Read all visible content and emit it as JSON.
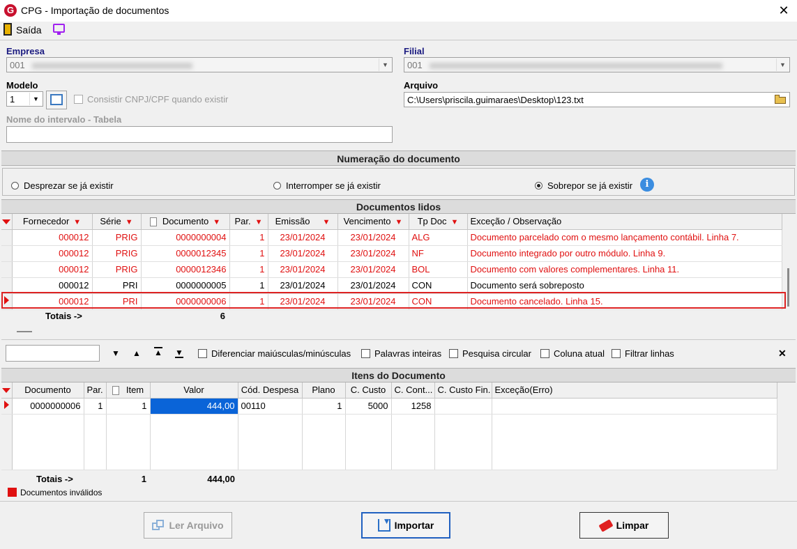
{
  "window": {
    "title": "CPG - Importação de documentos",
    "logo_letter": "G",
    "close": "✕"
  },
  "toolbar": {
    "exit_label": "Saída"
  },
  "form": {
    "empresa_label": "Empresa",
    "empresa_value": "001",
    "filial_label": "Filial",
    "filial_value": "001",
    "modelo_label": "Modelo",
    "modelo_value": "1",
    "consistir_label": "Consistir CNPJ/CPF quando existir",
    "arquivo_label": "Arquivo",
    "arquivo_value": "C:\\Users\\priscila.guimaraes\\Desktop\\123.txt",
    "intervalo_label": "Nome do intervalo - Tabela",
    "intervalo_value": ""
  },
  "numeracao": {
    "title": "Numeração do documento",
    "options": [
      "Desprezar se já existir",
      "Interromper se já existir",
      "Sobrepor se já existir"
    ],
    "selected": "Sobrepor se já existir",
    "info": "i"
  },
  "docs": {
    "title": "Documentos lidos",
    "columns": [
      "Fornecedor",
      "Série",
      "Documento",
      "Par.",
      "Emissão",
      "Vencimento",
      "Tp Doc",
      "Exceção / Observação"
    ],
    "rows": [
      {
        "fornecedor": "000012",
        "serie": "PRIG",
        "documento": "0000000004",
        "par": "1",
        "emissao": "23/01/2024",
        "vencimento": "23/01/2024",
        "tpdoc": "ALG",
        "obs": "Documento parcelado com o mesmo lançamento contábil. Linha 7."
      },
      {
        "fornecedor": "000012",
        "serie": "PRIG",
        "documento": "0000012345",
        "par": "1",
        "emissao": "23/01/2024",
        "vencimento": "23/01/2024",
        "tpdoc": "NF",
        "obs": "Documento integrado por outro módulo. Linha 9."
      },
      {
        "fornecedor": "000012",
        "serie": "PRIG",
        "documento": "0000012346",
        "par": "1",
        "emissao": "23/01/2024",
        "vencimento": "23/01/2024",
        "tpdoc": "BOL",
        "obs": "Documento com valores complementares. Linha 11."
      },
      {
        "fornecedor": "000012",
        "serie": "PRI",
        "documento": "0000000005",
        "par": "1",
        "emissao": "23/01/2024",
        "vencimento": "23/01/2024",
        "tpdoc": "CON",
        "obs": "Documento será sobreposto"
      },
      {
        "fornecedor": "000012",
        "serie": "PRI",
        "documento": "0000000006",
        "par": "1",
        "emissao": "23/01/2024",
        "vencimento": "23/01/2024",
        "tpdoc": "CON",
        "obs": "Documento cancelado. Linha 15."
      }
    ],
    "totals_label": "Totais ->",
    "totals_count": "6"
  },
  "search": {
    "value": "",
    "options": [
      "Diferenciar maiúsculas/minúsculas",
      "Palavras inteiras",
      "Pesquisa circular",
      "Coluna atual",
      "Filtrar linhas"
    ],
    "close": "✕"
  },
  "itens": {
    "title": "Itens do Documento",
    "columns": [
      "Documento",
      "Par.",
      "Item",
      "Valor",
      "Cód. Despesa",
      "Plano",
      "C. Custo",
      "C. Cont...",
      "C. Custo Fin.",
      "Exceção(Erro)"
    ],
    "rows": [
      {
        "documento": "0000000006",
        "par": "1",
        "item": "1",
        "valor": "444,00",
        "despesa": "00110",
        "plano": "1",
        "ccusto": "5000",
        "ccont": "1258",
        "ccustofin": "",
        "excecao": ""
      }
    ],
    "totals_label": "Totais ->",
    "totals_item": "1",
    "totals_valor": "444,00"
  },
  "legend": {
    "label": "Documentos inválidos",
    "color": "#e01010"
  },
  "buttons": {
    "ler": "Ler Arquivo",
    "importar": "Importar",
    "limpar": "Limpar"
  }
}
